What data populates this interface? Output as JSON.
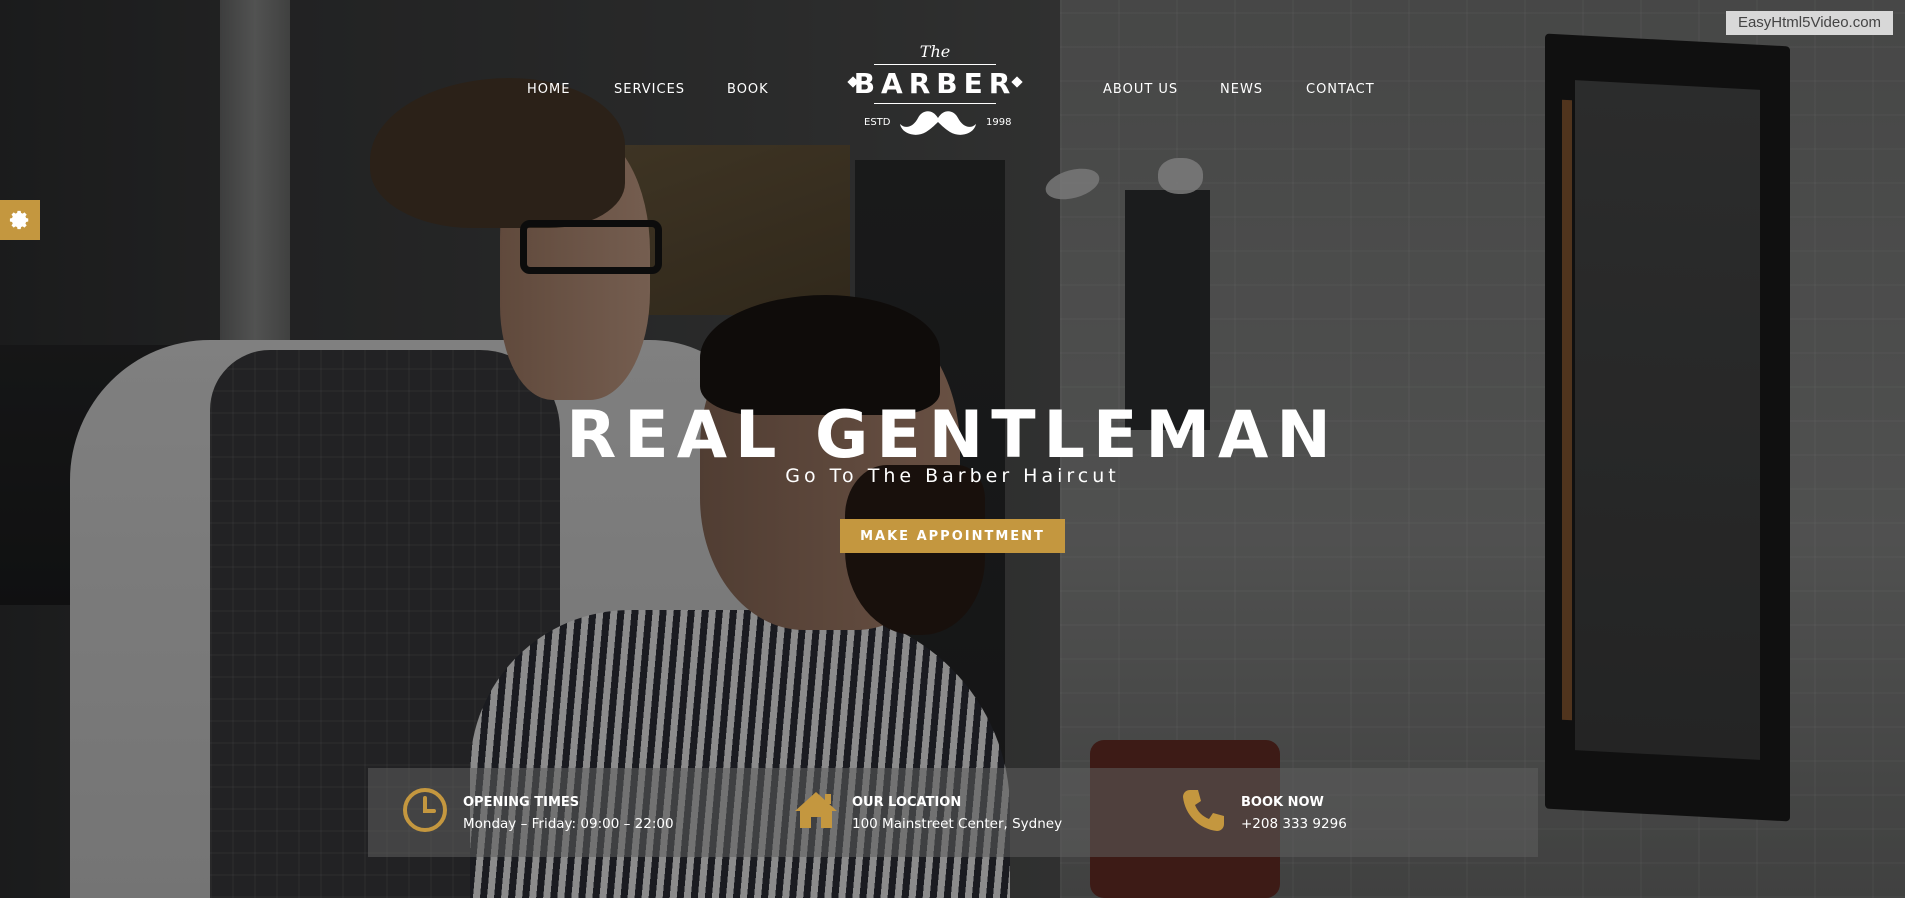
{
  "nav": {
    "left": [
      "HOME",
      "SERVICES",
      "BOOK"
    ],
    "right": [
      "ABOUT US",
      "NEWS",
      "CONTACT"
    ]
  },
  "logo": {
    "the": "The",
    "word": "BARBER",
    "estd": "ESTD",
    "year": "1998",
    "icon": "mustache-icon"
  },
  "hero": {
    "title": "REAL GENTLEMAN",
    "subtitle": "Go To The Barber Haircut",
    "cta": "MAKE APPOINTMENT"
  },
  "info": [
    {
      "icon": "clock-icon",
      "heading": "OPENING TIMES",
      "text": "Monday – Friday: 09:00 – 22:00"
    },
    {
      "icon": "home-icon",
      "heading": "OUR LOCATION",
      "text": "100 Mainstreet Center, Sydney"
    },
    {
      "icon": "phone-icon",
      "heading": "BOOK NOW",
      "text": "+208 333 9296"
    }
  ],
  "settings": {
    "icon": "gear-icon"
  },
  "watermark": "EasyHtml5Video.com",
  "colors": {
    "accent": "#c4973f",
    "overlay": "#000000",
    "text": "#ffffff",
    "info_bar": "#5f5f5f"
  }
}
